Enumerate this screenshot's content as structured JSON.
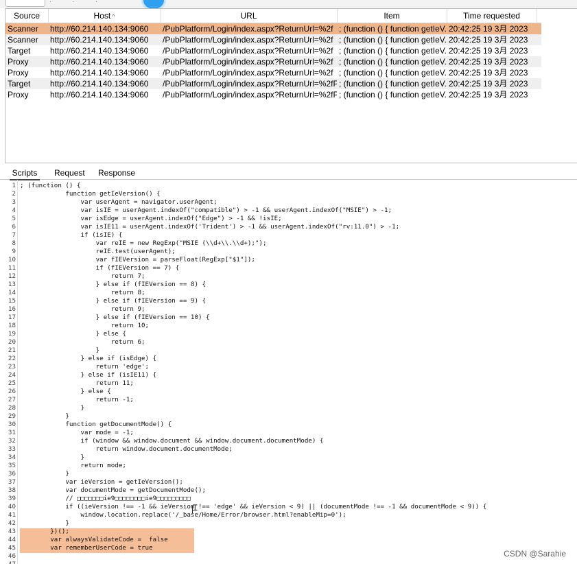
{
  "table": {
    "columns": [
      "Source",
      "Host",
      "URL",
      "Item",
      "Time requested"
    ],
    "sort_indicator": "^",
    "rows": [
      {
        "source": "Scanner",
        "host": "http://60.214.140.134:9060",
        "url": "/PubPlatform/Login/index.aspx?ReturnUrl=%2f",
        "item": "; (function () { function getIeV...",
        "time": "20:42:25 19 3月 2023"
      },
      {
        "source": "Scanner",
        "host": "http://60.214.140.134:9060",
        "url": "/PubPlatform/Login/index.aspx?ReturnUrl=%2f",
        "item": "; (function () { function getIeV...",
        "time": "20:42:25 19 3月 2023"
      },
      {
        "source": "Target",
        "host": "http://60.214.140.134:9060",
        "url": "/PubPlatform/Login/index.aspx?ReturnUrl=%2f",
        "item": "; (function () { function getIeV...",
        "time": "20:42:25 19 3月 2023"
      },
      {
        "source": "Proxy",
        "host": "http://60.214.140.134:9060",
        "url": "/PubPlatform/Login/index.aspx?ReturnUrl=%2f",
        "item": "; (function () { function getIeV...",
        "time": "20:42:25 19 3月 2023"
      },
      {
        "source": "Proxy",
        "host": "http://60.214.140.134:9060",
        "url": "/PubPlatform/Login/index.aspx?ReturnUrl=%2f",
        "item": "; (function () { function getIeV...",
        "time": "20:42:25 19 3月 2023"
      },
      {
        "source": "Target",
        "host": "http://60.214.140.134:9060",
        "url": "/PubPlatform/Login/index.aspx?ReturnUrl=%2fP...",
        "item": "; (function () { function getIeV...",
        "time": "20:42:25 19 3月 2023"
      },
      {
        "source": "Proxy",
        "host": "http://60.214.140.134:9060",
        "url": "/PubPlatform/Login/index.aspx?ReturnUrl=%2fP...",
        "item": "; (function () { function getIeV...",
        "time": "20:42:25 19 3月 2023"
      }
    ],
    "selected_row": 0
  },
  "tabs": [
    "Scripts",
    "Request",
    "Response"
  ],
  "active_tab": 0,
  "code_lines": [
    "; (function () {",
    "            function getIeVersion() {",
    "                var userAgent = navigator.userAgent;",
    "                var isIE = userAgent.indexOf(\"compatible\") > -1 && userAgent.indexOf(\"MSIE\") > -1;",
    "                var isEdge = userAgent.indexOf(\"Edge\") > -1 && !isIE;",
    "                var isIE11 = userAgent.indexOf('Trident') > -1 && userAgent.indexOf(\"rv:11.0\") > -1;",
    "                if (isIE) {",
    "                    var reIE = new RegExp(\"MSIE (\\\\d+\\\\.\\\\d+);\");",
    "                    reIE.test(userAgent);",
    "                    var fIEVersion = parseFloat(RegExp[\"$1\"]);",
    "                    if (fIEVersion == 7) {",
    "                        return 7;",
    "                    } else if (fIEVersion == 8) {",
    "                        return 8;",
    "                    } else if (fIEVersion == 9) {",
    "                        return 9;",
    "                    } else if (fIEVersion == 10) {",
    "                        return 10;",
    "                    } else {",
    "                        return 6;",
    "                    }",
    "                } else if (isEdge) {",
    "                    return 'edge';",
    "                } else if (isIE11) {",
    "                    return 11;",
    "                } else {",
    "                    return -1;",
    "                }",
    "            }",
    "            function getDocumentMode() {",
    "                var mode = -1;",
    "                if (window && window.document && window.document.documentMode) {",
    "                    return window.document.documentMode;",
    "                }",
    "                return mode;",
    "            }",
    "            var ieVersion = getIeVersion();",
    "            var documentMode = getDocumentMode();",
    "            // □□□□□□□ie9□□□□□□□□ie9□□□□□□□□□",
    "            if ((ieVersion !== -1 && ieVersion !== 'edge' && ieVersion < 9) || (documentMode !== -1 && documentMode < 9)) {",
    "                window.location.replace('/_base/Home/Error/browser.html?enableMip=0');",
    "            }",
    "        })();",
    "        var alwaysValidateCode =  false",
    "        var rememberUserCode = true",
    "",
    ""
  ],
  "highlight_lines": [
    43,
    44,
    45
  ],
  "watermark": "CSDN @Sarahie"
}
